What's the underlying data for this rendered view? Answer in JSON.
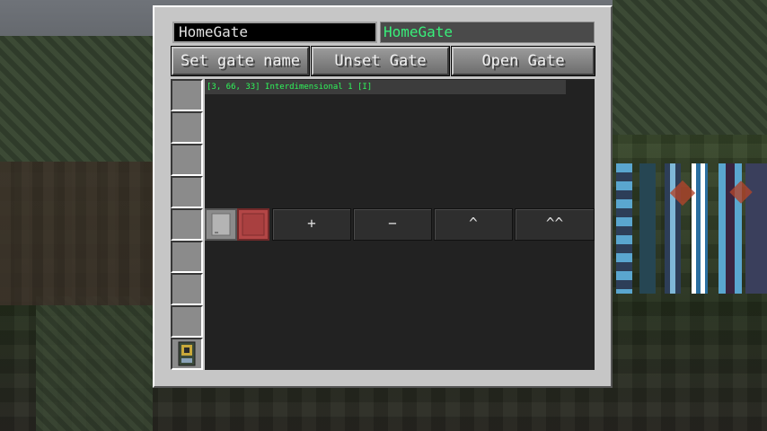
{
  "gate_name_input": {
    "value": "HomeGate"
  },
  "gate_name_display": "HomeGate",
  "buttons": {
    "set_gate_name": "Set gate name",
    "unset_gate": "Unset Gate",
    "open_gate": "Open Gate"
  },
  "gate_list": [
    {
      "label": "[3, 66, 33] Interdimensional 1 [I]"
    }
  ],
  "row_controls": {
    "plus": "+",
    "minus": "−",
    "up": "^",
    "top": "^^"
  },
  "colors": {
    "panel": "#c6c6c6",
    "content_bg": "#222222",
    "gate_display_text": "#38f07a",
    "list_text": "#2ff55a"
  },
  "icons": {
    "upgrade_slot_item": "gate-controller-icon",
    "row_item_a": "empty-card-icon",
    "row_item_b": "red-card-icon"
  }
}
